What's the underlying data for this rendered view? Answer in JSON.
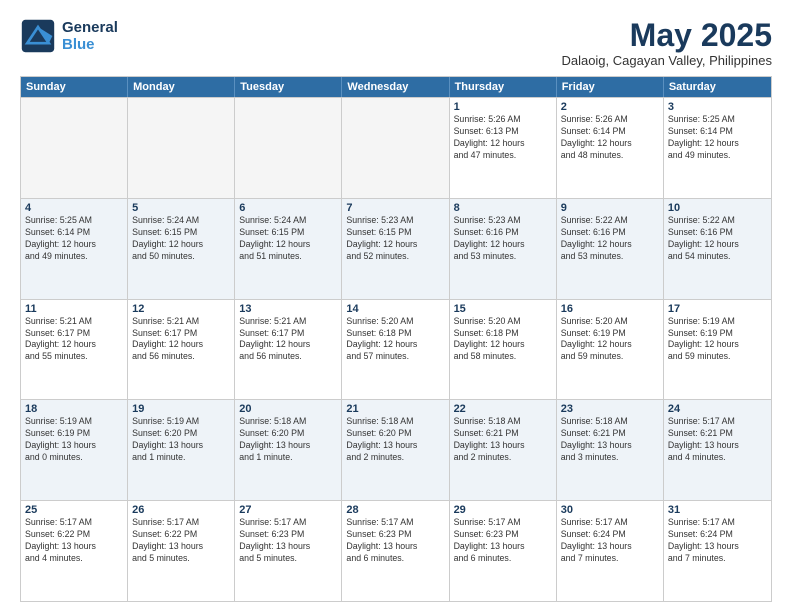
{
  "header": {
    "logo_line1": "General",
    "logo_line2": "Blue",
    "month": "May 2025",
    "location": "Dalaoig, Cagayan Valley, Philippines"
  },
  "weekdays": [
    "Sunday",
    "Monday",
    "Tuesday",
    "Wednesday",
    "Thursday",
    "Friday",
    "Saturday"
  ],
  "rows": [
    {
      "cells": [
        {
          "day": "",
          "info": "",
          "empty": true
        },
        {
          "day": "",
          "info": "",
          "empty": true
        },
        {
          "day": "",
          "info": "",
          "empty": true
        },
        {
          "day": "",
          "info": "",
          "empty": true
        },
        {
          "day": "1",
          "info": "Sunrise: 5:26 AM\nSunset: 6:13 PM\nDaylight: 12 hours\nand 47 minutes.",
          "empty": false
        },
        {
          "day": "2",
          "info": "Sunrise: 5:26 AM\nSunset: 6:14 PM\nDaylight: 12 hours\nand 48 minutes.",
          "empty": false
        },
        {
          "day": "3",
          "info": "Sunrise: 5:25 AM\nSunset: 6:14 PM\nDaylight: 12 hours\nand 49 minutes.",
          "empty": false
        }
      ],
      "alt": false
    },
    {
      "cells": [
        {
          "day": "4",
          "info": "Sunrise: 5:25 AM\nSunset: 6:14 PM\nDaylight: 12 hours\nand 49 minutes.",
          "empty": false
        },
        {
          "day": "5",
          "info": "Sunrise: 5:24 AM\nSunset: 6:15 PM\nDaylight: 12 hours\nand 50 minutes.",
          "empty": false
        },
        {
          "day": "6",
          "info": "Sunrise: 5:24 AM\nSunset: 6:15 PM\nDaylight: 12 hours\nand 51 minutes.",
          "empty": false
        },
        {
          "day": "7",
          "info": "Sunrise: 5:23 AM\nSunset: 6:15 PM\nDaylight: 12 hours\nand 52 minutes.",
          "empty": false
        },
        {
          "day": "8",
          "info": "Sunrise: 5:23 AM\nSunset: 6:16 PM\nDaylight: 12 hours\nand 53 minutes.",
          "empty": false
        },
        {
          "day": "9",
          "info": "Sunrise: 5:22 AM\nSunset: 6:16 PM\nDaylight: 12 hours\nand 53 minutes.",
          "empty": false
        },
        {
          "day": "10",
          "info": "Sunrise: 5:22 AM\nSunset: 6:16 PM\nDaylight: 12 hours\nand 54 minutes.",
          "empty": false
        }
      ],
      "alt": true
    },
    {
      "cells": [
        {
          "day": "11",
          "info": "Sunrise: 5:21 AM\nSunset: 6:17 PM\nDaylight: 12 hours\nand 55 minutes.",
          "empty": false
        },
        {
          "day": "12",
          "info": "Sunrise: 5:21 AM\nSunset: 6:17 PM\nDaylight: 12 hours\nand 56 minutes.",
          "empty": false
        },
        {
          "day": "13",
          "info": "Sunrise: 5:21 AM\nSunset: 6:17 PM\nDaylight: 12 hours\nand 56 minutes.",
          "empty": false
        },
        {
          "day": "14",
          "info": "Sunrise: 5:20 AM\nSunset: 6:18 PM\nDaylight: 12 hours\nand 57 minutes.",
          "empty": false
        },
        {
          "day": "15",
          "info": "Sunrise: 5:20 AM\nSunset: 6:18 PM\nDaylight: 12 hours\nand 58 minutes.",
          "empty": false
        },
        {
          "day": "16",
          "info": "Sunrise: 5:20 AM\nSunset: 6:19 PM\nDaylight: 12 hours\nand 59 minutes.",
          "empty": false
        },
        {
          "day": "17",
          "info": "Sunrise: 5:19 AM\nSunset: 6:19 PM\nDaylight: 12 hours\nand 59 minutes.",
          "empty": false
        }
      ],
      "alt": false
    },
    {
      "cells": [
        {
          "day": "18",
          "info": "Sunrise: 5:19 AM\nSunset: 6:19 PM\nDaylight: 13 hours\nand 0 minutes.",
          "empty": false
        },
        {
          "day": "19",
          "info": "Sunrise: 5:19 AM\nSunset: 6:20 PM\nDaylight: 13 hours\nand 1 minute.",
          "empty": false
        },
        {
          "day": "20",
          "info": "Sunrise: 5:18 AM\nSunset: 6:20 PM\nDaylight: 13 hours\nand 1 minute.",
          "empty": false
        },
        {
          "day": "21",
          "info": "Sunrise: 5:18 AM\nSunset: 6:20 PM\nDaylight: 13 hours\nand 2 minutes.",
          "empty": false
        },
        {
          "day": "22",
          "info": "Sunrise: 5:18 AM\nSunset: 6:21 PM\nDaylight: 13 hours\nand 2 minutes.",
          "empty": false
        },
        {
          "day": "23",
          "info": "Sunrise: 5:18 AM\nSunset: 6:21 PM\nDaylight: 13 hours\nand 3 minutes.",
          "empty": false
        },
        {
          "day": "24",
          "info": "Sunrise: 5:17 AM\nSunset: 6:21 PM\nDaylight: 13 hours\nand 4 minutes.",
          "empty": false
        }
      ],
      "alt": true
    },
    {
      "cells": [
        {
          "day": "25",
          "info": "Sunrise: 5:17 AM\nSunset: 6:22 PM\nDaylight: 13 hours\nand 4 minutes.",
          "empty": false
        },
        {
          "day": "26",
          "info": "Sunrise: 5:17 AM\nSunset: 6:22 PM\nDaylight: 13 hours\nand 5 minutes.",
          "empty": false
        },
        {
          "day": "27",
          "info": "Sunrise: 5:17 AM\nSunset: 6:23 PM\nDaylight: 13 hours\nand 5 minutes.",
          "empty": false
        },
        {
          "day": "28",
          "info": "Sunrise: 5:17 AM\nSunset: 6:23 PM\nDaylight: 13 hours\nand 6 minutes.",
          "empty": false
        },
        {
          "day": "29",
          "info": "Sunrise: 5:17 AM\nSunset: 6:23 PM\nDaylight: 13 hours\nand 6 minutes.",
          "empty": false
        },
        {
          "day": "30",
          "info": "Sunrise: 5:17 AM\nSunset: 6:24 PM\nDaylight: 13 hours\nand 7 minutes.",
          "empty": false
        },
        {
          "day": "31",
          "info": "Sunrise: 5:17 AM\nSunset: 6:24 PM\nDaylight: 13 hours\nand 7 minutes.",
          "empty": false
        }
      ],
      "alt": false
    }
  ]
}
